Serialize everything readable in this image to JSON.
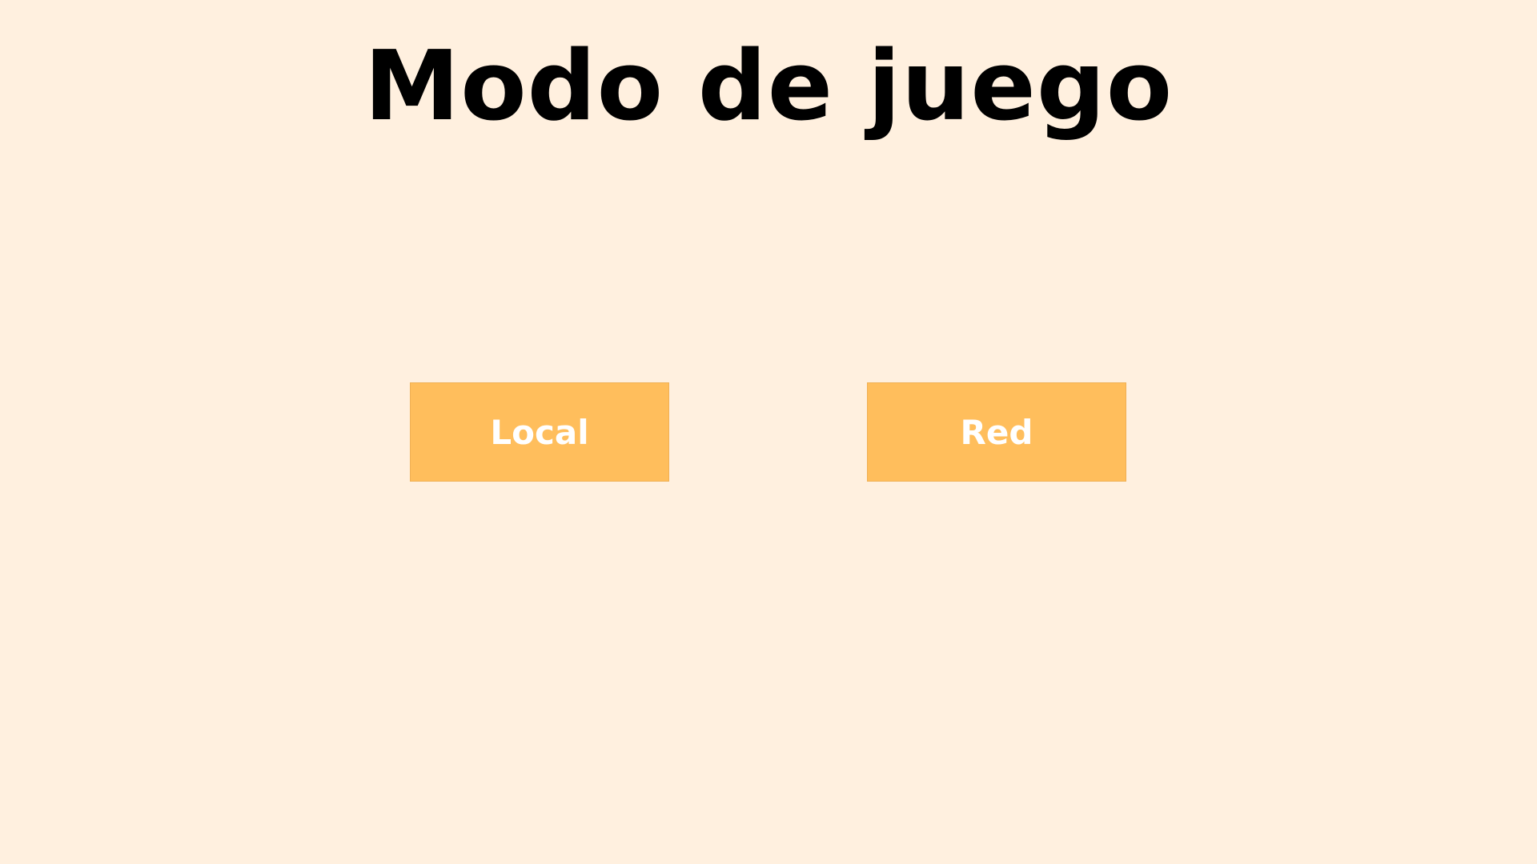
{
  "screen": {
    "title": "Modo de juego",
    "background_color": "#fff0df"
  },
  "buttons": {
    "local_label": "Local",
    "network_label": "Red",
    "color": "#ffbe5c",
    "text_color": "#ffffff"
  }
}
